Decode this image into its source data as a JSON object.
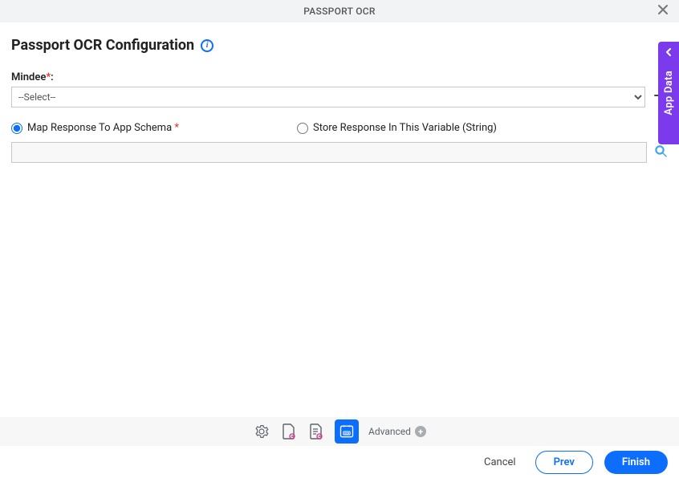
{
  "header": {
    "title": "PASSPORT OCR"
  },
  "page": {
    "heading": "Passport OCR Configuration",
    "mindee_label": "Mindee",
    "select_placeholder": "--Select--",
    "radio_map": "Map Response To App Schema",
    "radio_store": "Store Response In This Variable (String)"
  },
  "toolbar": {
    "advanced": "Advanced"
  },
  "footer": {
    "cancel": "Cancel",
    "prev": "Prev",
    "finish": "Finish"
  },
  "side": {
    "label": "App Data"
  }
}
